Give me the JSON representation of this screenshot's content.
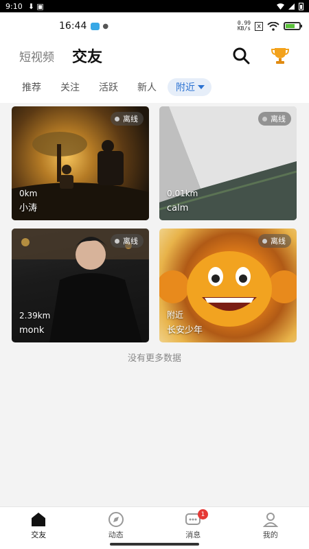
{
  "outer_status": {
    "time": "9:10",
    "glyphs": "⬇ ▣"
  },
  "inner_status": {
    "time": "16:44",
    "speed_top": "0.99",
    "speed_bottom": "KB/s",
    "x_label": "x"
  },
  "header": {
    "tab_video": "短视频",
    "tab_friend": "交友",
    "search_icon": "search-icon",
    "trophy_icon": "trophy-icon"
  },
  "filters": {
    "items": [
      "推荐",
      "关注",
      "活跃",
      "新人"
    ],
    "active": "附近"
  },
  "cards": [
    {
      "status": "离线",
      "distance": "0km",
      "name": "小涛"
    },
    {
      "status": "离线",
      "distance": "0.01km",
      "name": "calm"
    },
    {
      "status": "离线",
      "distance": "2.39km",
      "name": "monk"
    },
    {
      "status": "离线",
      "distance": "附近",
      "name": "长安少年"
    }
  ],
  "no_more": "没有更多数据",
  "tabbar": {
    "tabs": [
      {
        "label": "交友",
        "icon": "home-icon"
      },
      {
        "label": "动态",
        "icon": "compass-icon"
      },
      {
        "label": "消息",
        "icon": "message-icon",
        "badge": "1"
      },
      {
        "label": "我的",
        "icon": "profile-icon"
      }
    ]
  }
}
